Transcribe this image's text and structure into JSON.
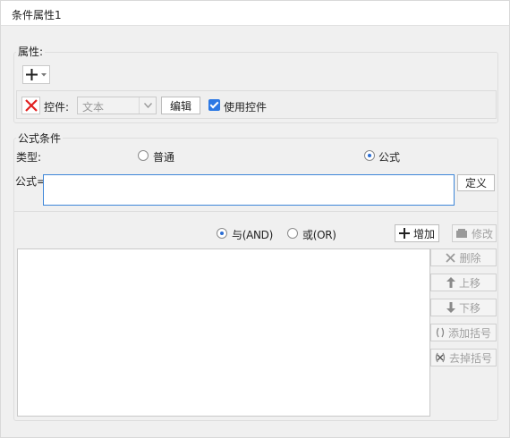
{
  "window": {
    "title": "条件属性1"
  },
  "properties": {
    "group_label": "属性:",
    "add_icon": "plus-icon",
    "control_row": {
      "delete_icon": "close-icon",
      "label": "控件:",
      "combo_value": "文本",
      "edit_button": "编辑",
      "use_control_label": "使用控件",
      "use_control_checked": true
    }
  },
  "formula_condition": {
    "group_label": "公式条件",
    "type_label": "类型:",
    "type_options": [
      {
        "label": "普通",
        "selected": false
      },
      {
        "label": "公式",
        "selected": true
      }
    ],
    "formula_label": "公式=",
    "formula_value": "",
    "define_button": "定义",
    "logic_options": [
      {
        "label": "与(AND)",
        "selected": true
      },
      {
        "label": "或(OR)",
        "selected": false
      }
    ],
    "add_button": "增加",
    "modify_button": "修改",
    "side_buttons": [
      {
        "label": "删除",
        "icon": "close-icon"
      },
      {
        "label": "上移",
        "icon": "arrow-up-icon"
      },
      {
        "label": "下移",
        "icon": "arrow-down-icon"
      },
      {
        "label": "添加括号",
        "icon": "parentheses-icon"
      },
      {
        "label": "去掉括号",
        "icon": "remove-parentheses-icon"
      }
    ]
  },
  "colors": {
    "accent": "#2b78e4",
    "delete_red": "#e02020",
    "disabled_text": "#a0a0a0"
  }
}
